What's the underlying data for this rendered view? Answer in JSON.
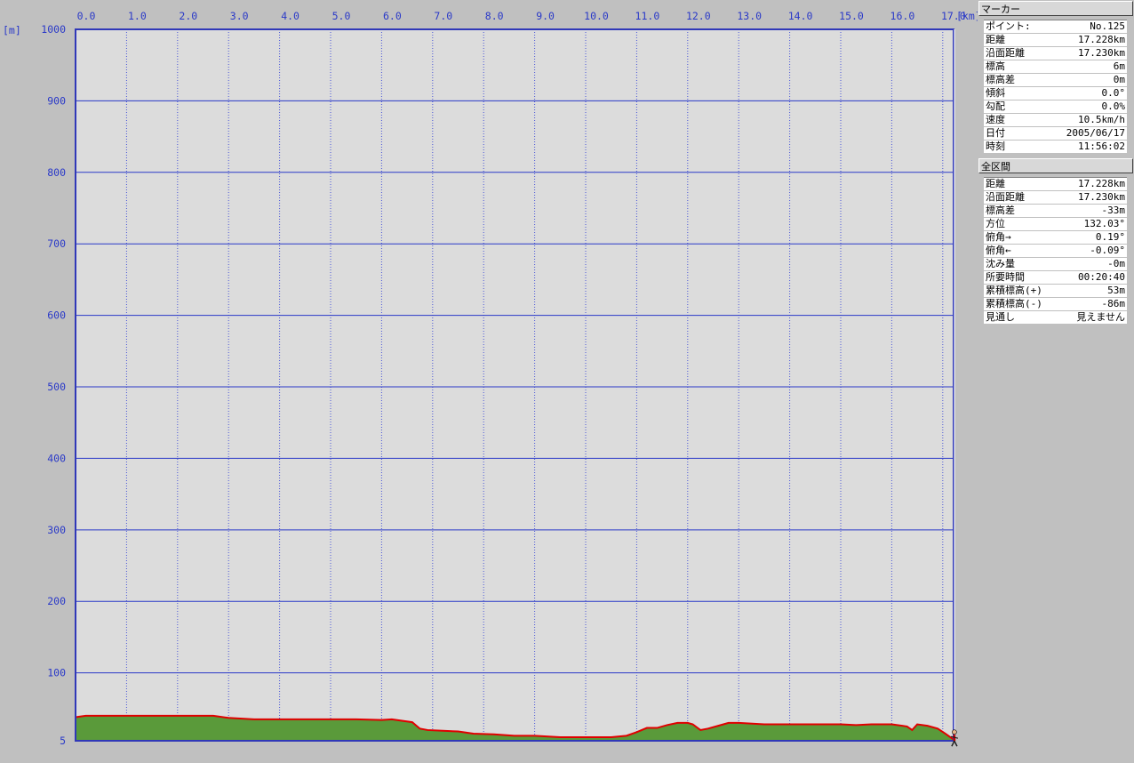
{
  "chart_data": {
    "type": "area",
    "xlabel": "[km]",
    "ylabel": "[m]",
    "xlim": [
      0,
      17.228
    ],
    "ylim": [
      5,
      1000
    ],
    "x_ticks": [
      "0.0",
      "1.0",
      "2.0",
      "3.0",
      "4.0",
      "5.0",
      "6.0",
      "7.0",
      "8.0",
      "9.0",
      "10.0",
      "11.0",
      "12.0",
      "13.0",
      "14.0",
      "15.0",
      "16.0",
      "17.0"
    ],
    "y_ticks": [
      "1000",
      "900",
      "800",
      "700",
      "600",
      "500",
      "400",
      "300",
      "200",
      "100",
      "5"
    ],
    "grid": true,
    "colors": {
      "plot_bg": "#dcdcdc",
      "grid_major": "#2a39c8",
      "grid_minor": "#4a56d8",
      "fill": "#5a9a3a",
      "line": "#e00000",
      "axis_text": "#2a39c8"
    },
    "series": [
      {
        "x": [
          0,
          0.2,
          0.5,
          1.0,
          2.0,
          2.7,
          3.0,
          3.5,
          4.0,
          5.0,
          5.5,
          6.0,
          6.2,
          6.4,
          6.6,
          6.75,
          6.9,
          7.2,
          7.5,
          7.8,
          8.2,
          8.6,
          9.0,
          9.5,
          10.0,
          10.5,
          10.8,
          11.0,
          11.2,
          11.4,
          11.6,
          11.8,
          12.0,
          12.1,
          12.25,
          12.4,
          12.6,
          12.8,
          13.0,
          13.5,
          14.0,
          14.5,
          15.0,
          15.3,
          15.6,
          16.0,
          16.3,
          16.4,
          16.5,
          16.7,
          16.9,
          17.05,
          17.228
        ],
        "y": [
          38,
          40,
          40,
          40,
          40,
          40,
          37,
          35,
          35,
          35,
          35,
          34,
          35,
          33,
          31,
          22,
          20,
          19,
          18,
          15,
          14,
          12,
          12,
          10,
          10,
          10,
          12,
          17,
          23,
          23,
          27,
          30,
          30,
          28,
          20,
          22,
          26,
          30,
          30,
          28,
          28,
          28,
          28,
          27,
          28,
          28,
          25,
          20,
          28,
          26,
          22,
          15,
          6
        ]
      }
    ]
  },
  "marker": {
    "header": "マーカー",
    "rows": [
      {
        "label": "ポイント:",
        "value": "No.125"
      },
      {
        "label": "距離",
        "value": "17.228km"
      },
      {
        "label": "沿面距離",
        "value": "17.230km"
      },
      {
        "label": "標高",
        "value": "6m"
      },
      {
        "label": "標高差",
        "value": "0m"
      },
      {
        "label": "傾斜",
        "value": "0.0°"
      },
      {
        "label": "勾配",
        "value": "0.0%"
      },
      {
        "label": "速度",
        "value": "10.5km/h"
      },
      {
        "label": "日付",
        "value": "2005/06/17"
      },
      {
        "label": "時刻",
        "value": "11:56:02"
      }
    ]
  },
  "total": {
    "header": "全区間",
    "rows": [
      {
        "label": "距離",
        "value": "17.228km"
      },
      {
        "label": "沿面距離",
        "value": "17.230km"
      },
      {
        "label": "標高差",
        "value": "-33m"
      },
      {
        "label": "方位",
        "value": "132.03°"
      },
      {
        "label": "俯角→",
        "value": "0.19°"
      },
      {
        "label": "俯角←",
        "value": "-0.09°"
      },
      {
        "label": "沈み量",
        "value": "-0m"
      },
      {
        "label": "所要時間",
        "value": "00:20:40"
      },
      {
        "label": "累積標高(+)",
        "value": "53m"
      },
      {
        "label": "累積標高(-)",
        "value": "-86m"
      },
      {
        "label": "見通し",
        "value": "見えません"
      }
    ]
  }
}
